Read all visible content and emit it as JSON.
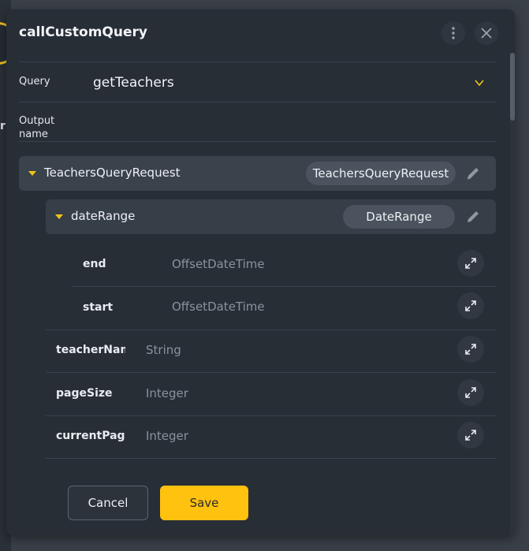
{
  "dialog": {
    "title": "callCustomQuery"
  },
  "fields": {
    "query_label": "Query",
    "query_value": "getTeachers",
    "output_label_line1": "Output",
    "output_label_line2": "name"
  },
  "tree": {
    "root": {
      "name": "TeachersQueryRequest",
      "type": "TeachersQueryRequest"
    },
    "date_range": {
      "name": "dateRange",
      "type": "DateRange"
    },
    "date_fields": [
      {
        "name": "end",
        "type": "OffsetDateTime"
      },
      {
        "name": "start",
        "type": "OffsetDateTime"
      }
    ],
    "fields": [
      {
        "name": "teacherName",
        "type": "String"
      },
      {
        "name": "pageSize",
        "type": "Integer"
      },
      {
        "name": "currentPage",
        "type": "Integer"
      }
    ]
  },
  "footer": {
    "cancel_label": "Cancel",
    "save_label": "Save"
  },
  "background": {
    "partial_char": "r"
  },
  "colors": {
    "accent": "#ffc20e",
    "dialog_bg": "#272e36",
    "row_bg": "#3a424c"
  }
}
